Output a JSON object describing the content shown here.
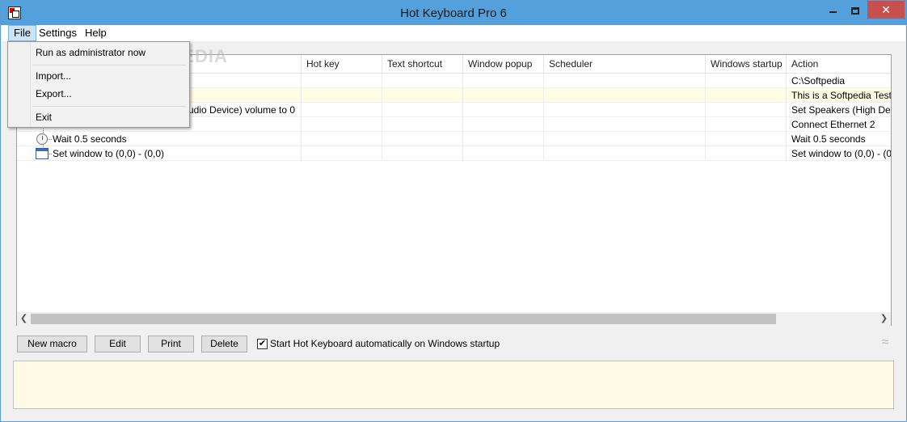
{
  "window": {
    "title": "Hot Keyboard Pro 6",
    "close_glyph": "✕"
  },
  "menubar": {
    "file": "File",
    "settings": "Settings",
    "help": "Help"
  },
  "file_menu": {
    "run_admin": "Run as administrator now",
    "import": "Import...",
    "export": "Export...",
    "exit": "Exit"
  },
  "watermark": "SOFTPEDIA",
  "columns": {
    "hotkey": "Hot key",
    "text_shortcut": "Text shortcut",
    "window_popup": "Window popup",
    "scheduler": "Scheduler",
    "windows_startup": "Windows startup",
    "action": "Action"
  },
  "rows": [
    {
      "name": "",
      "action": "C:\\Softpedia"
    },
    {
      "name": "",
      "action": "This is a Softpedia Test"
    },
    {
      "name": "udio Device) volume to 0",
      "action": "Set Speakers (High Defi"
    },
    {
      "name": "",
      "action": "Connect Ethernet 2"
    },
    {
      "name": "Wait 0.5 seconds",
      "action": "Wait 0.5 seconds"
    },
    {
      "name": "Set window to (0,0) - (0,0)",
      "action": "Set window to (0,0) - (0,"
    }
  ],
  "buttons": {
    "new_macro": "New macro",
    "edit": "Edit",
    "print": "Print",
    "delete": "Delete"
  },
  "startup_checkbox": {
    "label": "Start Hot Keyboard automatically on Windows startup",
    "checked": true,
    "check_glyph": "✔"
  },
  "icons": {
    "app": "app-icon",
    "timer": "timer-icon",
    "window": "window-icon",
    "wifi": "wifi-icon"
  }
}
